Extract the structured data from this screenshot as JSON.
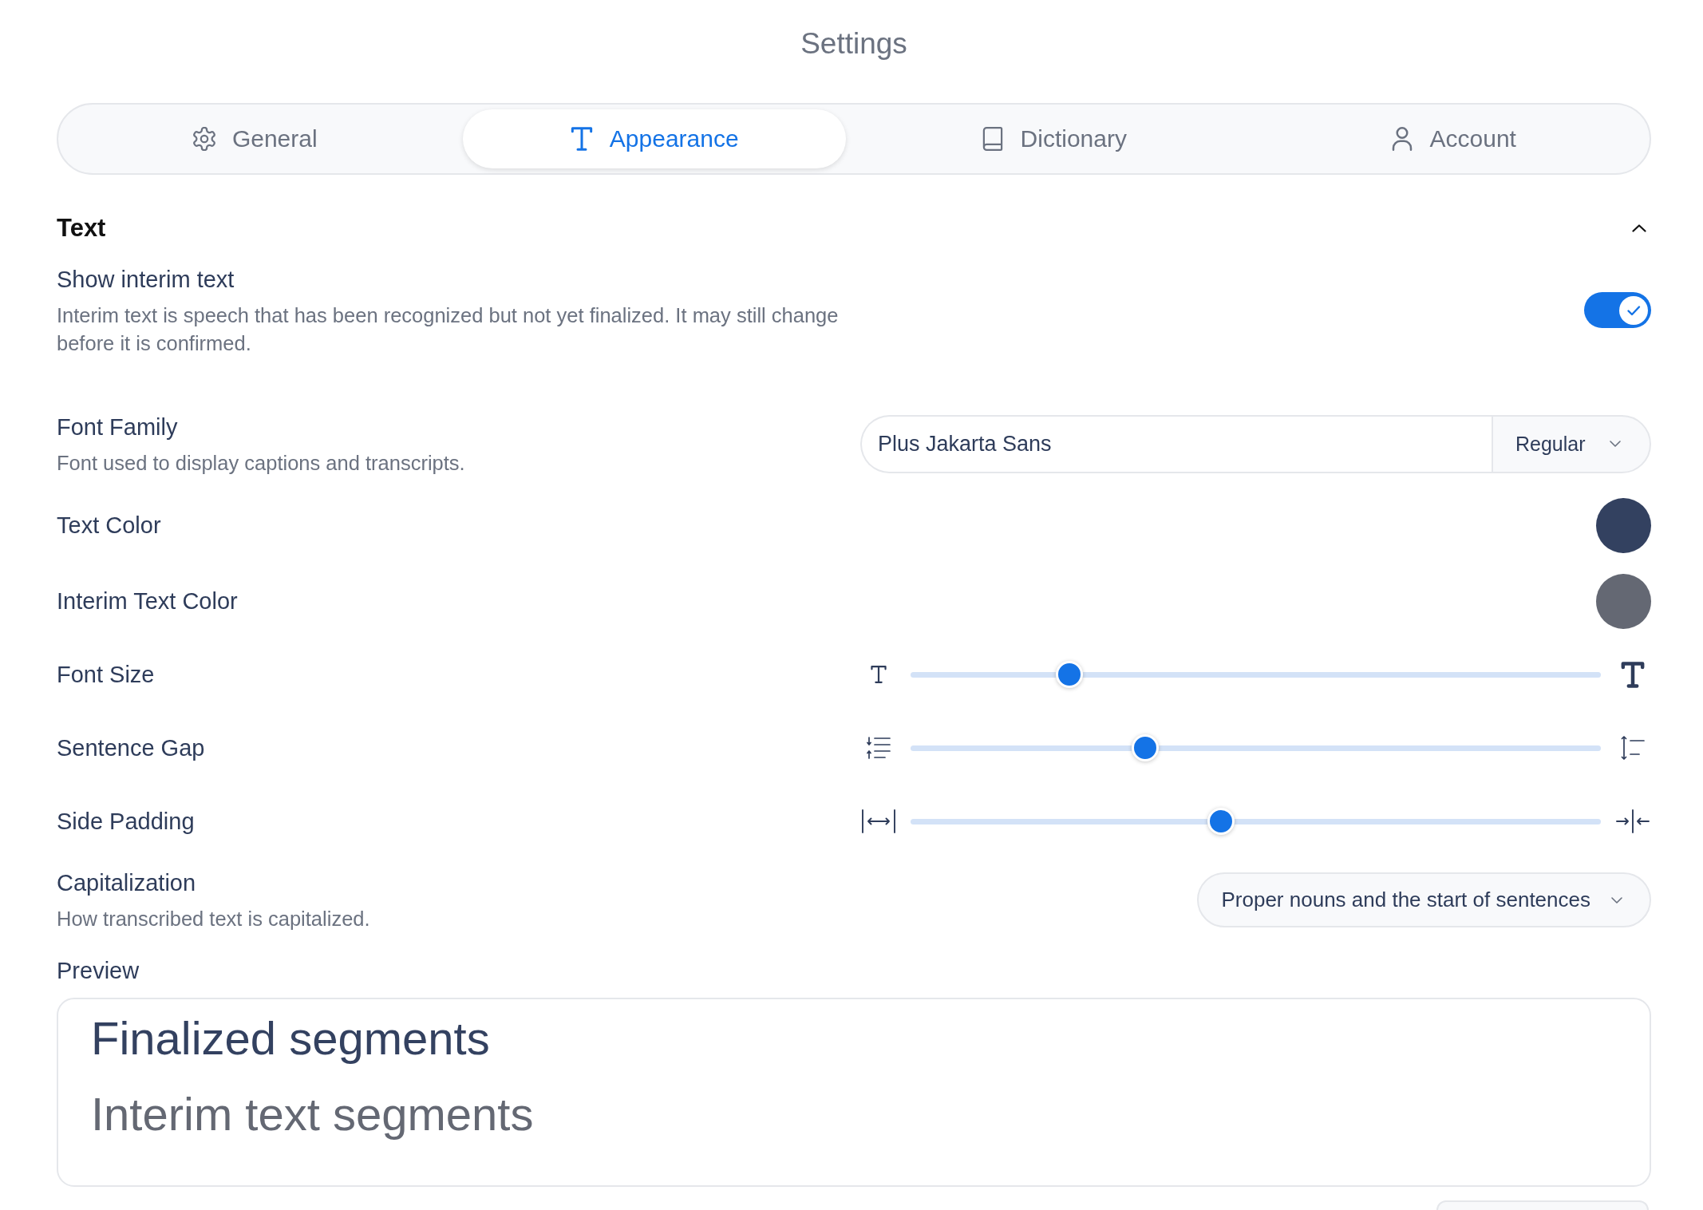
{
  "window": {
    "title": "Settings"
  },
  "tabs": [
    {
      "label": "General",
      "selected": false
    },
    {
      "label": "Appearance",
      "selected": true
    },
    {
      "label": "Dictionary",
      "selected": false
    },
    {
      "label": "Account",
      "selected": false
    }
  ],
  "section": {
    "title": "Text",
    "expanded": true,
    "settings": [
      {
        "kind": "toggle",
        "label": "Show interim text",
        "description": "Interim text is speech that has been recognized but not yet finalized. It may still change before it is confirmed.",
        "on": true
      },
      {
        "kind": "font",
        "label": "Font Family",
        "description": "Font used to display captions and transcripts.",
        "value": "Plus Jakarta Sans",
        "weight": "Regular"
      },
      {
        "kind": "color",
        "label": "Text Color",
        "color": "#334160"
      },
      {
        "kind": "color",
        "label": "Interim Text Color",
        "color": "#646873"
      },
      {
        "kind": "slider",
        "label": "Font Size",
        "level": 0.23
      },
      {
        "kind": "slider",
        "label": "Sentence Gap",
        "level": 0.34
      },
      {
        "kind": "slider",
        "label": "Side Padding",
        "level": 0.45
      },
      {
        "kind": "select",
        "label": "Capitalization",
        "description": "How transcribed text is capitalized.",
        "value": "Proper nouns and the start of sentences"
      }
    ]
  },
  "preview": {
    "label": "Preview",
    "finalized_text": "Finalized segments",
    "interim_text": "Interim text segments"
  }
}
